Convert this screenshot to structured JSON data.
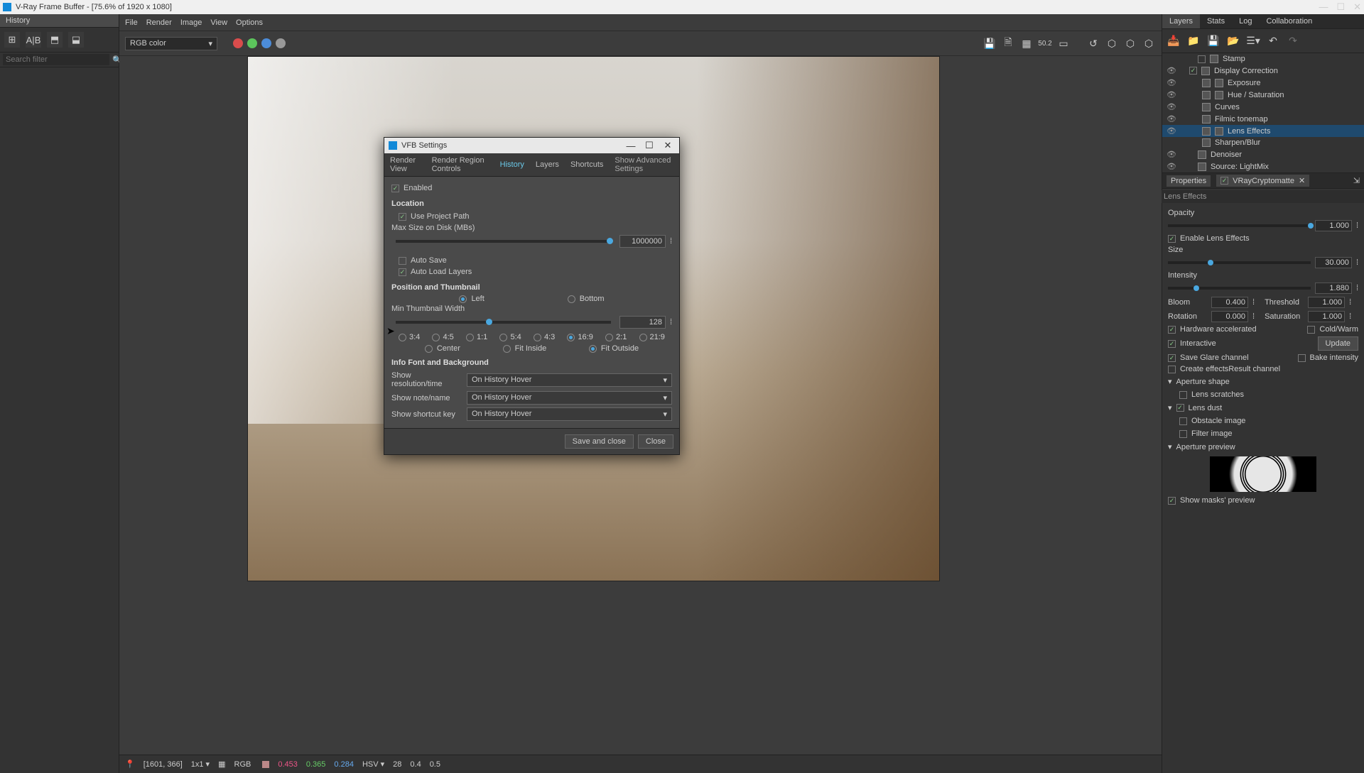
{
  "titlebar": {
    "title": "V-Ray Frame Buffer - [75.6% of 1920 x 1080]"
  },
  "menu": [
    "File",
    "Render",
    "Image",
    "View",
    "Options"
  ],
  "channelSelect": "RGB color",
  "leftPanel": {
    "tab": "History",
    "searchPlaceholder": "Search filter"
  },
  "toolbar_icons": {
    "save": "💾",
    "save2": "🗎",
    "region": "▦",
    "scale": "50.2",
    "mono": "▭",
    "link": "↺",
    "hex1": "⬡",
    "hex2": "⬡",
    "hex3": "⬡"
  },
  "status": {
    "coords": "[1601, 366]",
    "zoom": "1x1 ▾",
    "mode": "RGB",
    "r": "0.453",
    "g": "0.365",
    "b": "0.284",
    "hsv": "HSV ▾",
    "h": "28",
    "s": "0.4",
    "v": "0.5"
  },
  "rightTabs": [
    "Layers",
    "Stats",
    "Log",
    "Collaboration"
  ],
  "layers": [
    {
      "name": "Stamp",
      "indent": 18,
      "eye": false,
      "box": true
    },
    {
      "name": "Display Correction",
      "indent": 6,
      "eye": true,
      "box": true,
      "checked": true
    },
    {
      "name": "Exposure",
      "indent": 24,
      "eye": true,
      "twoIcon": true
    },
    {
      "name": "Hue / Saturation",
      "indent": 24,
      "eye": true,
      "twoIcon": true
    },
    {
      "name": "Curves",
      "indent": 24,
      "eye": true
    },
    {
      "name": "Filmic tonemap",
      "indent": 24,
      "eye": true
    },
    {
      "name": "Lens Effects",
      "indent": 24,
      "eye": true,
      "sel": true,
      "twoIcon": true
    },
    {
      "name": "Sharpen/Blur",
      "indent": 24,
      "eye": false
    },
    {
      "name": "Denoiser",
      "indent": 18,
      "eye": true
    },
    {
      "name": "Source: LightMix",
      "indent": 18,
      "eye": true
    }
  ],
  "props": {
    "headerTab": "Properties",
    "cryptoLabel": "VRayCryptomatte",
    "sectionLabel": "Lens Effects",
    "opacity": {
      "label": "Opacity",
      "value": "1.000"
    },
    "enableLens": "Enable Lens Effects",
    "size": {
      "label": "Size",
      "value": "30.000"
    },
    "intensity": {
      "label": "Intensity",
      "value": "1.880"
    },
    "bloom": {
      "label": "Bloom",
      "value": "0.400"
    },
    "threshold": {
      "label": "Threshold",
      "value": "1.000"
    },
    "rotation": {
      "label": "Rotation",
      "value": "0.000"
    },
    "saturation": {
      "label": "Saturation",
      "value": "1.000"
    },
    "hwAccel": "Hardware accelerated",
    "coldWarm": "Cold/Warm",
    "interactive": "Interactive",
    "updateBtn": "Update",
    "saveGlare": "Save Glare channel",
    "bakeIntensity": "Bake intensity",
    "createEffects": "Create effectsResult channel",
    "apertureShape": "Aperture shape",
    "lensScratches": "Lens scratches",
    "lensDust": "Lens dust",
    "obstacleImage": "Obstacle image",
    "filterImage": "Filter image",
    "aperturePreview": "Aperture preview",
    "showMasksPreview": "Show masks' preview"
  },
  "modal": {
    "title": "VFB Settings",
    "tabs": [
      "Render View",
      "Render Region Controls",
      "History",
      "Layers",
      "Shortcuts"
    ],
    "activeTab": "History",
    "advLabel": "Show Advanced Settings",
    "enabled": "Enabled",
    "locationTitle": "Location",
    "useProjectPath": "Use Project Path",
    "maxSizeLabel": "Max Size on Disk (MBs)",
    "maxSizeValue": "1000000",
    "autoSave": "Auto Save",
    "autoLoad": "Auto Load Layers",
    "posThumbTitle": "Position and Thumbnail",
    "posLeft": "Left",
    "posBottom": "Bottom",
    "minThumbLabel": "Min Thumbnail Width",
    "minThumbValue": "128",
    "ratios": [
      "3:4",
      "4:5",
      "1:1",
      "5:4",
      "4:3",
      "16:9",
      "2:1",
      "21:9"
    ],
    "fit": [
      "Center",
      "Fit Inside",
      "Fit Outside"
    ],
    "infoTitle": "Info Font and Background",
    "showRes": "Show resolution/time",
    "showNote": "Show note/name",
    "showShortcut": "Show shortcut key",
    "dropdownVal": "On History Hover",
    "saveClose": "Save and close",
    "close": "Close"
  }
}
